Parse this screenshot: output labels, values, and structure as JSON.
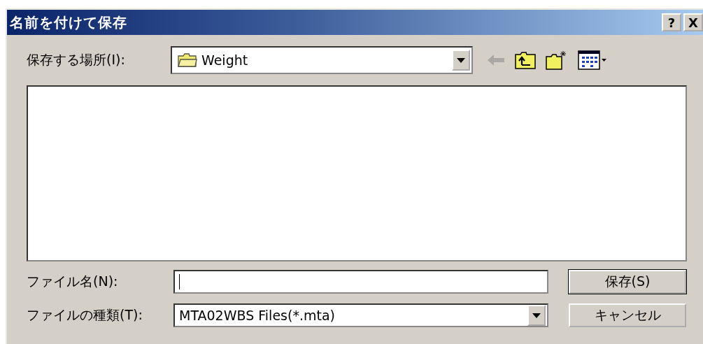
{
  "window": {
    "title": "名前を付けて保存",
    "title_buttons": [
      "?",
      "X"
    ]
  },
  "location": {
    "label": "保存する場所(I):",
    "value": "Weight"
  },
  "toolbar": [
    {
      "kind": "back",
      "disabled": true
    },
    {
      "kind": "up",
      "disabled": false
    },
    {
      "kind": "new-folder",
      "disabled": false
    },
    {
      "kind": "view-menu",
      "disabled": false
    }
  ],
  "file_name": {
    "label": "ファイル名(N):"
  },
  "file_type": {
    "label": "ファイルの種類(T):",
    "value": "MTA02WBS Files(*.mta)"
  },
  "buttons": [
    {
      "label": "保存(S)",
      "default": true
    },
    {
      "label": "キャンセル",
      "default": false
    }
  ]
}
